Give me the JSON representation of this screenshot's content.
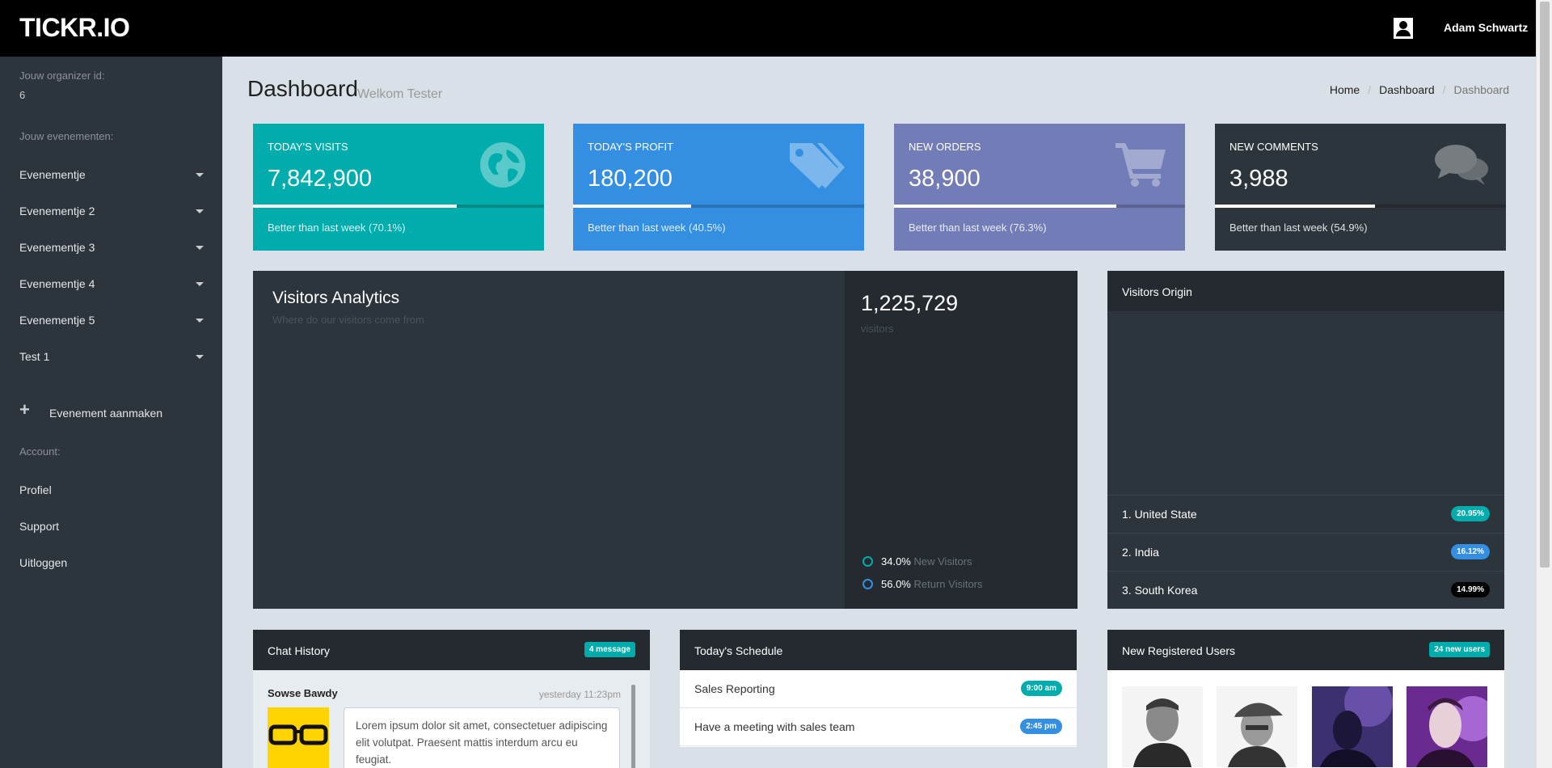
{
  "header": {
    "brand": "TICKR.IO",
    "user_name": "Adam Schwartz"
  },
  "sidebar": {
    "organizer_label": "Jouw organizer id:",
    "organizer_id": "6",
    "events_label": "Jouw evenementen:",
    "events": [
      {
        "label": "Evenementje"
      },
      {
        "label": "Evenementje 2"
      },
      {
        "label": "Evenementje 3"
      },
      {
        "label": "Evenementje 4"
      },
      {
        "label": "Evenementje 5"
      },
      {
        "label": "Test 1"
      }
    ],
    "create_event": "Evenement aanmaken",
    "account_label": "Account:",
    "account_items": [
      {
        "label": "Profiel"
      },
      {
        "label": "Support"
      },
      {
        "label": "Uitloggen"
      }
    ]
  },
  "page": {
    "title": "Dashboard",
    "subtitle": "Welkom Tester",
    "breadcrumb": [
      "Home",
      "Dashboard",
      "Dashboard"
    ]
  },
  "stats": [
    {
      "label": "TODAY'S VISITS",
      "value": "7,842,900",
      "progress": 0.701,
      "footer": "Better than last week (70.1%)",
      "color": "#00acac",
      "icon": "globe-icon"
    },
    {
      "label": "TODAY'S PROFIT",
      "value": "180,200",
      "progress": 0.405,
      "footer": "Better than last week (40.5%)",
      "color": "#348fe2",
      "icon": "tags-icon"
    },
    {
      "label": "NEW ORDERS",
      "value": "38,900",
      "progress": 0.763,
      "footer": "Better than last week (76.3%)",
      "color": "#727cb6",
      "icon": "cart-icon"
    },
    {
      "label": "NEW COMMENTS",
      "value": "3,988",
      "progress": 0.549,
      "footer": "Better than last week (54.9%)",
      "color": "#2d353c",
      "icon": "comments-icon"
    }
  ],
  "visitors_analytics": {
    "title": "Visitors Analytics",
    "subtitle": "Where do our visitors come from",
    "total": "1,225,729",
    "total_label": "visitors",
    "legend": [
      {
        "value": "34.0%",
        "label": "New Visitors",
        "color": "#00acac"
      },
      {
        "value": "56.0%",
        "label": "Return Visitors",
        "color": "#348fe2"
      }
    ]
  },
  "visitors_origin": {
    "title": "Visitors Origin",
    "rows": [
      {
        "name": "1. United State",
        "value": "20.95%",
        "color": "#00acac"
      },
      {
        "name": "2. India",
        "value": "16.12%",
        "color": "#348fe2"
      },
      {
        "name": "3. South Korea",
        "value": "14.99%",
        "color": "#000000"
      }
    ]
  },
  "chat": {
    "title": "Chat History",
    "badge": "4 message",
    "author": "Sowse Bawdy",
    "time": "yesterday 11:23pm",
    "message": "Lorem ipsum dolor sit amet, consectetuer adipiscing elit volutpat. Praesent mattis interdum arcu eu feugiat."
  },
  "schedule": {
    "title": "Today's Schedule",
    "items": [
      {
        "label": "Sales Reporting",
        "time": "9:00 am",
        "color": "#00acac"
      },
      {
        "label": "Have a meeting with sales team",
        "time": "2:45 pm",
        "color": "#348fe2"
      }
    ]
  },
  "new_users": {
    "title": "New Registered Users",
    "badge": "24 new users"
  }
}
